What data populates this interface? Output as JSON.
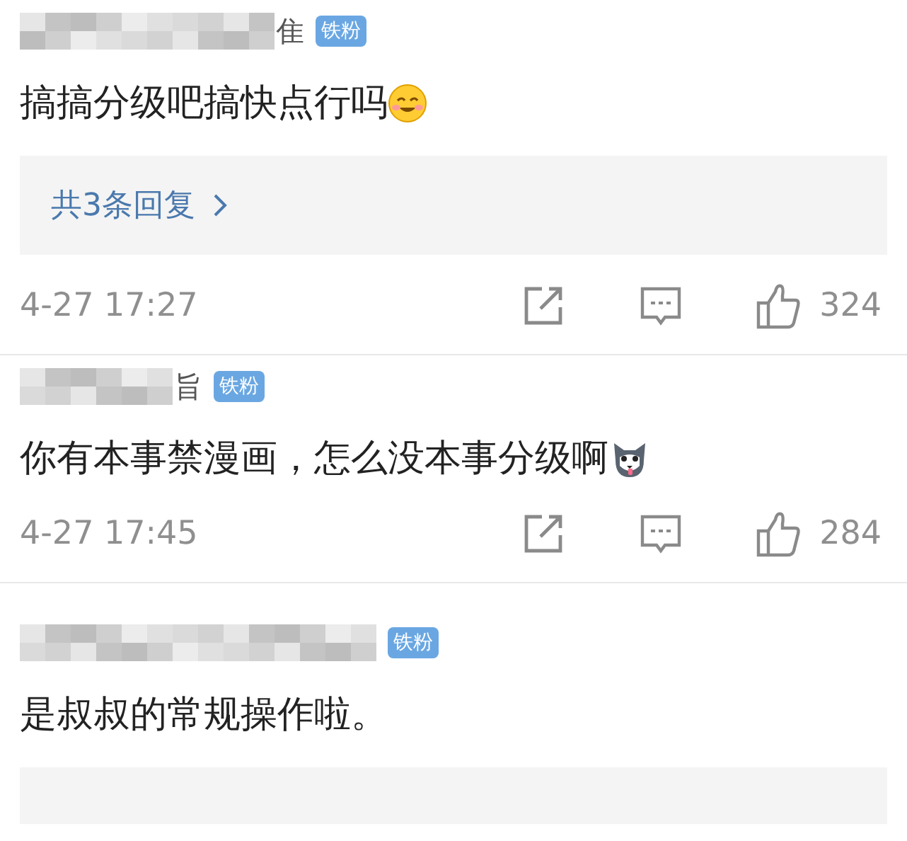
{
  "comments": [
    {
      "name_fragment": "隹",
      "badge": "铁粉",
      "text": "搞搞分级吧搞快点行吗",
      "emoji": {
        "kind": "smile"
      },
      "reply_box": true,
      "reply_label": "共3条回复",
      "time": "4-27 17:27",
      "likes": "324"
    },
    {
      "name_fragment": "旨",
      "badge": "铁粉",
      "text": "你有本事禁漫画，怎么没本事分级啊",
      "emoji": {
        "kind": "dog"
      },
      "reply_box": false,
      "time": "4-27 17:45",
      "likes": "284"
    },
    {
      "badge": "铁粉",
      "text": "是叔叔的常规操作啦。",
      "reply_box": true
    }
  ]
}
